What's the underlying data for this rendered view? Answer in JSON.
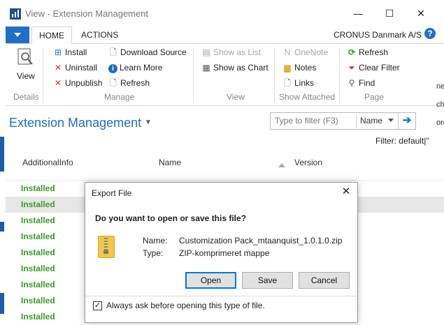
{
  "window": {
    "title": "View - Extension Management",
    "minimize_glyph": "—",
    "maximize_glyph": "☐",
    "close_glyph": "✕"
  },
  "ribbon_tabs": [
    {
      "label": "HOME",
      "active": true
    },
    {
      "label": "ACTIONS",
      "active": false
    }
  ],
  "company": "CRONUS Danmark A/S",
  "help_glyph": "?",
  "ribbon": {
    "details": {
      "view_label": "View",
      "group_label": "Details"
    },
    "manage": {
      "group_label": "Manage",
      "items": [
        {
          "label": "Install",
          "icon": "install-icon",
          "glyph": "⁝⊞",
          "color": "#1e6fc5"
        },
        {
          "label": "Uninstall",
          "icon": "uninstall-icon",
          "glyph": "✕",
          "color": "#c0392b"
        },
        {
          "label": "Unpublish",
          "icon": "unpublish-icon",
          "glyph": "✕",
          "color": "#c0392b"
        },
        {
          "label": "Download Source",
          "icon": "download-source-icon",
          "glyph": "🗎",
          "color": "#666666"
        },
        {
          "label": "Learn More",
          "icon": "info-icon",
          "glyph": "i",
          "color": "#1e6fc5"
        },
        {
          "label": "Refresh",
          "icon": "refresh-icon",
          "glyph": "🗎",
          "color": "#666666"
        }
      ]
    },
    "view": {
      "group_label": "View",
      "items": [
        {
          "label": "Show as List",
          "icon": "show-as-list-icon",
          "disabled": true
        },
        {
          "label": "Show as Chart",
          "icon": "show-as-chart-icon",
          "disabled": false
        }
      ]
    },
    "show_attached": {
      "group_label": "Show Attached",
      "items": [
        {
          "label": "OneNote",
          "icon": "onenote-icon",
          "disabled": true
        },
        {
          "label": "Notes",
          "icon": "notes-icon",
          "disabled": false
        },
        {
          "label": "Links",
          "icon": "links-icon",
          "disabled": false
        }
      ]
    },
    "page": {
      "group_label": "Page",
      "items": [
        {
          "label": "Refresh",
          "icon": "page-refresh-icon"
        },
        {
          "label": "Clear Filter",
          "icon": "clear-filter-icon"
        },
        {
          "label": "Find",
          "icon": "find-icon"
        }
      ]
    }
  },
  "page_title": "Extension Management",
  "filter": {
    "placeholder": "Type to filter (F3)",
    "field": "Name",
    "status": "Filter: default|''"
  },
  "columns": [
    "AdditionalInfo",
    "Name",
    "Version"
  ],
  "rows": [
    "Installed",
    "Installed",
    "Installed",
    "Installed",
    "Installed",
    "Installed",
    "Installed",
    "Installed",
    "Installed"
  ],
  "selected_row": 1,
  "dialog": {
    "title": "Export File",
    "close_glyph": "✕",
    "question": "Do you want to open or save this file?",
    "name_key": "Name:",
    "name_value": "Customization Pack_mtaanquist_1.0.1.0.zip",
    "type_key": "Type:",
    "type_value": "ZIP-komprimeret mappe",
    "open_label": "Open",
    "save_label": "Save",
    "cancel_label": "Cancel",
    "checkbox_label": "Always ask before opening this type of file.",
    "checkbox_checked": true,
    "check_glyph": "✓"
  },
  "background_fragments": [
    "ne",
    "cho",
    "ord"
  ]
}
